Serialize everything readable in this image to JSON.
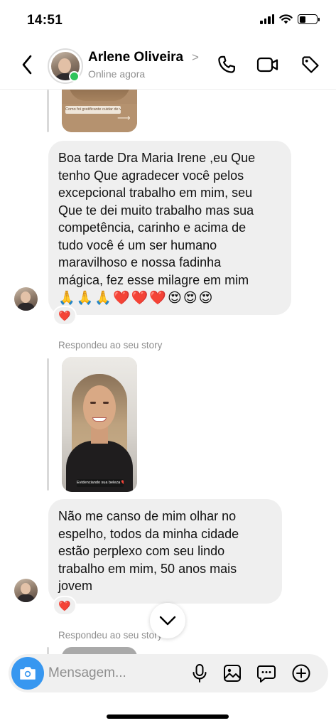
{
  "status_bar": {
    "time": "14:51"
  },
  "header": {
    "contact_name": "Arlene Oliveira",
    "name_chevron": ">",
    "status": "Online agora",
    "icons": [
      "back-arrow-icon",
      "phone-icon",
      "video-camera-icon",
      "tag-icon"
    ]
  },
  "messages": [
    {
      "type": "story_reply",
      "story_caption": "Como foi gratificante cuidar de você!",
      "story_arrow": "⟶"
    },
    {
      "type": "text",
      "lines": [
        "Boa tarde Dra Maria Irene  ,eu Que",
        "tenho Que  agradecer  você  pelos",
        "excepcional trabalho  em mim, seu",
        "Que te dei muito trabalho  mas sua",
        "competência,  carinho e  acima de",
        "tudo  você  é um ser humano",
        "maravilhoso e  nossa fadinha",
        "mágica,  fez esse milagre  em mim"
      ],
      "emojis": [
        "🙏",
        "🙏",
        "🙏",
        "❤️",
        "❤️",
        "❤️",
        "😍",
        "😍",
        "😍"
      ],
      "reaction": "❤️"
    },
    {
      "type": "story_reply",
      "label": "Respondeu ao seu story",
      "story_caption": "Evidenciando sua beleza ❤️"
    },
    {
      "type": "text",
      "lines": [
        "Não  me canso de mim  olhar  no",
        "espelho,  todos  da minha cidade",
        "estão  perplexo  com seu  lindo",
        "trabalho  em mim,  50 anos  mais",
        "jovem"
      ],
      "reaction": "❤️"
    },
    {
      "type": "story_reply",
      "label": "Respondeu ao seu story"
    }
  ],
  "composer": {
    "placeholder": "Mensagem...",
    "icons": [
      "camera-icon",
      "microphone-icon",
      "gallery-icon",
      "sticker-icon",
      "plus-icon"
    ]
  },
  "colors": {
    "accent_blue": "#3797f0",
    "online_green": "#2fc45b",
    "bubble_gray": "#efefef"
  }
}
